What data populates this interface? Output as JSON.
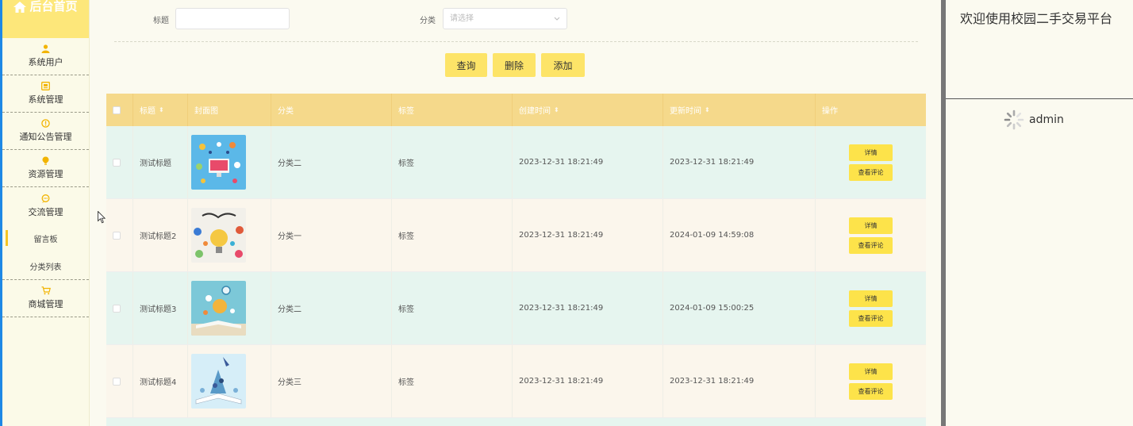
{
  "brand": {
    "title": "后台首页"
  },
  "sidebar": {
    "items": [
      {
        "label": "系统用户",
        "icon": "user-icon"
      },
      {
        "label": "系统管理",
        "icon": "system-icon"
      },
      {
        "label": "通知公告管理",
        "icon": "notice-icon"
      },
      {
        "label": "资源管理",
        "icon": "resource-icon"
      },
      {
        "label": "交流管理",
        "icon": "chat-icon"
      }
    ],
    "sub_items": [
      {
        "label": "留言板",
        "active": true
      },
      {
        "label": "分类列表",
        "active": false
      }
    ],
    "shop": {
      "label": "商城管理",
      "icon": "cart-icon"
    }
  },
  "filter": {
    "title_label": "标题",
    "title_value": "",
    "category_label": "分类",
    "category_placeholder": "请选择"
  },
  "toolbar": {
    "query": "查询",
    "delete": "删除",
    "add": "添加"
  },
  "table": {
    "headers": {
      "title": "标题",
      "cover": "封面图",
      "category": "分类",
      "tag": "标签",
      "created": "创建时间",
      "updated": "更新时间",
      "ops": "操作"
    },
    "rows": [
      {
        "title": "测试标题",
        "category": "分类二",
        "tag": "标签",
        "created": "2023-12-31 18:21:49",
        "updated": "2023-12-31 18:21:49",
        "detail": "详情",
        "comments": "查看评论"
      },
      {
        "title": "测试标题2",
        "category": "分类一",
        "tag": "标签",
        "created": "2023-12-31 18:21:49",
        "updated": "2024-01-09 14:59:08",
        "detail": "详情",
        "comments": "查看评论"
      },
      {
        "title": "测试标题3",
        "category": "分类二",
        "tag": "标签",
        "created": "2023-12-31 18:21:49",
        "updated": "2024-01-09 15:00:25",
        "detail": "详情",
        "comments": "查看评论"
      },
      {
        "title": "测试标题4",
        "category": "分类三",
        "tag": "标签",
        "created": "2023-12-31 18:21:49",
        "updated": "2023-12-31 18:21:49",
        "detail": "详情",
        "comments": "查看评论"
      }
    ]
  },
  "right_panel": {
    "welcome": "欢迎使用校园二手交易平台",
    "username": "admin"
  },
  "colors": {
    "accent": "#fde468",
    "header": "#f5d98b",
    "row_green": "#e6f5ef",
    "row_cream": "#fbf6ec"
  }
}
